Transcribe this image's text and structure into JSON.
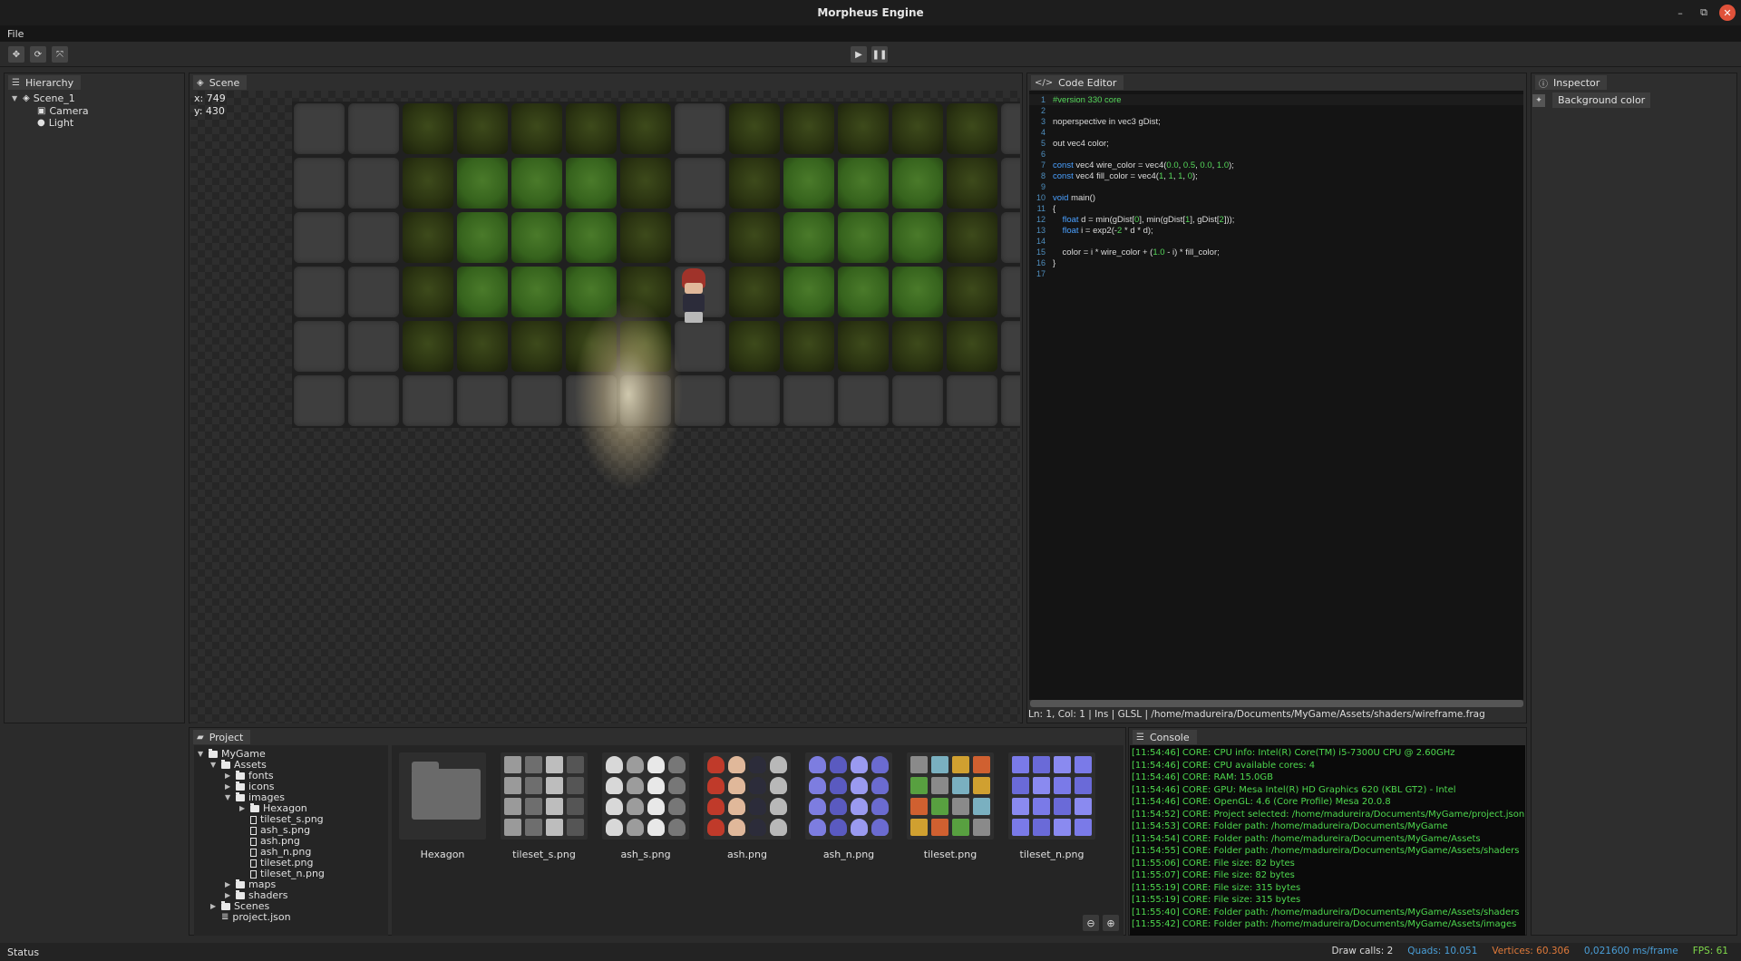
{
  "window": {
    "title": "Morpheus Engine"
  },
  "menu": {
    "file": "File"
  },
  "hierarchy": {
    "tab": "Hierarchy",
    "scene": "Scene_1",
    "children": [
      "Camera",
      "Light"
    ]
  },
  "scene": {
    "tab": "Scene",
    "x_label": "x: 749",
    "y_label": "y: 430"
  },
  "code_editor": {
    "tab": "Code Editor",
    "lines": [
      "#version 330 core",
      "",
      "noperspective in vec3 gDist;",
      "",
      "out vec4 color;",
      "",
      "const vec4 wire_color = vec4(0.0, 0.5, 0.0, 1.0);",
      "const vec4 fill_color = vec4(1, 1, 1, 0);",
      "",
      "void main()",
      "{",
      "    float d = min(gDist[0], min(gDist[1], gDist[2]));",
      "    float i = exp2(-2 * d * d);",
      "",
      "    color = i * wire_color + (1.0 - i) * fill_color;",
      "}",
      ""
    ],
    "status": "Ln: 1, Col: 1 | Ins | GLSL | /home/madureira/Documents/MyGame/Assets/shaders/wireframe.frag"
  },
  "inspector": {
    "tab": "Inspector",
    "background_color_label": "Background color"
  },
  "project": {
    "tab": "Project",
    "tree": {
      "root": "MyGame",
      "assets": "Assets",
      "fonts": "fonts",
      "icons": "icons",
      "images": "images",
      "hexagon": "Hexagon",
      "image_files": [
        "tileset_s.png",
        "ash_s.png",
        "ash.png",
        "ash_n.png",
        "tileset.png",
        "tileset_n.png"
      ],
      "maps": "maps",
      "shaders": "shaders",
      "scenes": "Scenes",
      "project_json": "project.json"
    },
    "assets": [
      "Hexagon",
      "tileset_s.png",
      "ash_s.png",
      "ash.png",
      "ash_n.png",
      "tileset.png",
      "tileset_n.png"
    ]
  },
  "console": {
    "tab": "Console",
    "lines": [
      "[11:54:46] CORE: CPU info: Intel(R) Core(TM) i5-7300U CPU @ 2.60GHz",
      "[11:54:46] CORE: CPU available cores: 4",
      "[11:54:46] CORE: RAM: 15.0GB",
      "[11:54:46] CORE: GPU: Mesa Intel(R) HD Graphics 620 (KBL GT2) - Intel",
      "[11:54:46] CORE: OpenGL: 4.6 (Core Profile) Mesa 20.0.8",
      "[11:54:52] CORE: Project selected: /home/madureira/Documents/MyGame/project.json",
      "[11:54:53] CORE: Folder path: /home/madureira/Documents/MyGame",
      "[11:54:54] CORE: Folder path: /home/madureira/Documents/MyGame/Assets",
      "[11:54:55] CORE: Folder path: /home/madureira/Documents/MyGame/Assets/shaders",
      "[11:55:06] CORE: File size: 82 bytes",
      "[11:55:07] CORE: File size: 82 bytes",
      "[11:55:19] CORE: File size: 315 bytes",
      "[11:55:19] CORE: File size: 315 bytes",
      "[11:55:40] CORE: Folder path: /home/madureira/Documents/MyGame/Assets/shaders",
      "[11:55:42] CORE: Folder path: /home/madureira/Documents/MyGame/Assets/images"
    ]
  },
  "statusbar": {
    "status": "Status",
    "draw_calls": "Draw calls: 2",
    "quads": "Quads: 10.051",
    "vertices": "Vertices: 60.306",
    "frame_time": "0,021600 ms/frame",
    "fps": "FPS: 61"
  },
  "colors": {
    "quads": "#4a9fd8",
    "vertices": "#e07a3a",
    "frame_time": "#4a9fd8",
    "fps": "#7fd84a",
    "console_text": "#4ed84e"
  }
}
